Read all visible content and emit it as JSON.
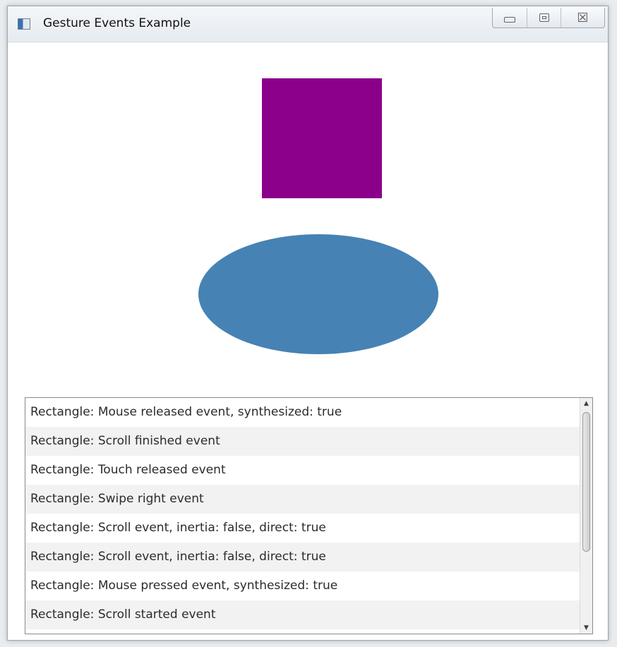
{
  "window": {
    "title": "Gesture Events Example",
    "controls": {
      "minimize_icon": "minimize-icon",
      "maximize_icon": "restore-icon",
      "close_glyph": "☒"
    }
  },
  "shapes": {
    "rectangle_color": "#8B008B",
    "ellipse_color": "#4682B4"
  },
  "event_log": {
    "items": [
      "Rectangle: Mouse released event, synthesized: true",
      "Rectangle: Scroll finished event",
      "Rectangle: Touch released event",
      "Rectangle: Swipe right event",
      "Rectangle: Scroll event, inertia: false, direct: true",
      "Rectangle: Scroll event, inertia: false, direct: true",
      "Rectangle: Mouse pressed event, synthesized: true",
      "Rectangle: Scroll started event"
    ],
    "scroll_up_glyph": "▲",
    "scroll_down_glyph": "▼"
  }
}
